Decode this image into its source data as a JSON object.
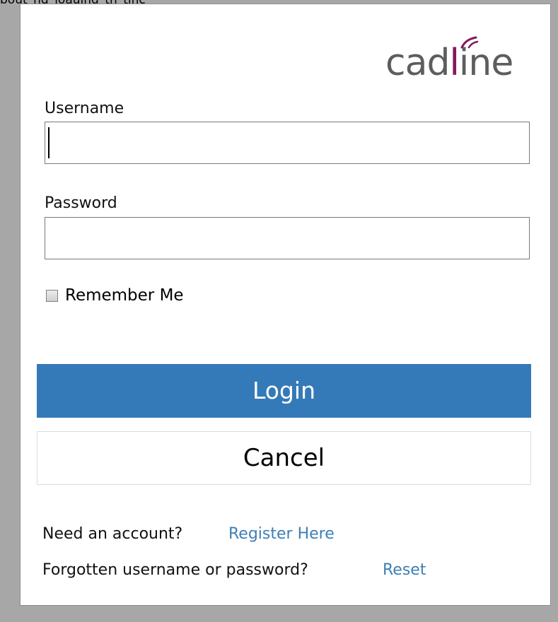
{
  "top_clip_text": "bout_ng_ioauing_th_tlhc",
  "logo": {
    "text_before_accent": "cad",
    "accent_text": "l",
    "text_after_accent": "ine",
    "accent_color": "#84185d",
    "text_color": "#5d5d5d"
  },
  "form": {
    "username_label": "Username",
    "username_value": "",
    "password_label": "Password",
    "password_value": "",
    "remember_label": "Remember Me",
    "remember_checked": false
  },
  "buttons": {
    "login_label": "Login",
    "cancel_label": "Cancel",
    "login_color": "#357ab8"
  },
  "links": {
    "need_account_text": "Need an account?",
    "register_label": "Register Here",
    "forgotten_text": "Forgotten username or password?",
    "reset_label": "Reset",
    "link_color": "#3d7fb6"
  }
}
